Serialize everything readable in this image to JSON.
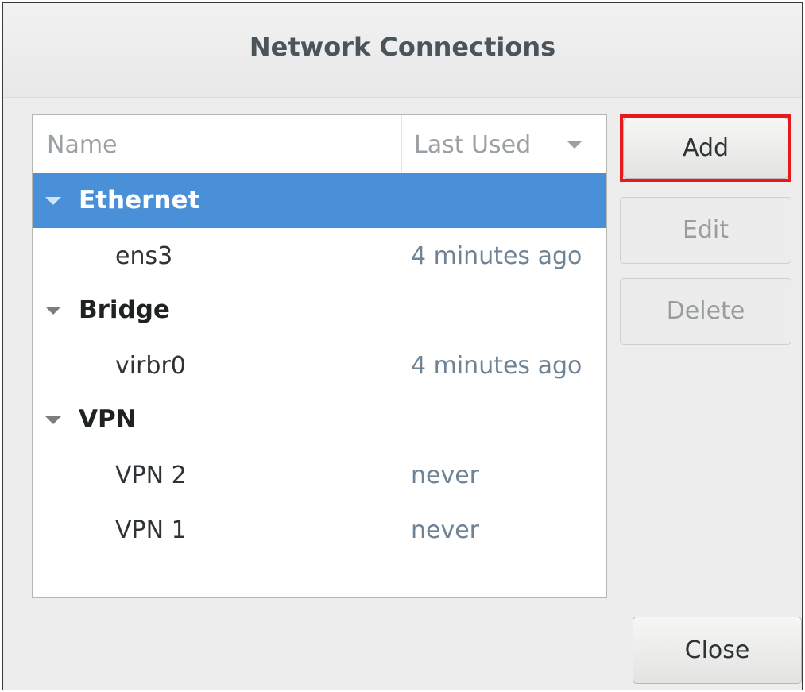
{
  "window": {
    "title": "Network Connections"
  },
  "list": {
    "columns": {
      "name": "Name",
      "last_used": "Last Used"
    },
    "groups": [
      {
        "label": "Ethernet",
        "selected": true,
        "connections": [
          {
            "name": "ens3",
            "last_used": "4 minutes ago"
          }
        ]
      },
      {
        "label": "Bridge",
        "selected": false,
        "connections": [
          {
            "name": "virbr0",
            "last_used": "4 minutes ago"
          }
        ]
      },
      {
        "label": "VPN",
        "selected": false,
        "connections": [
          {
            "name": "VPN 2",
            "last_used": "never"
          },
          {
            "name": "VPN 1",
            "last_used": "never"
          }
        ]
      }
    ]
  },
  "buttons": {
    "add": "Add",
    "edit": "Edit",
    "delete": "Delete",
    "close": "Close"
  },
  "icons": {
    "sort": "chevron-down-icon",
    "expander": "triangle-down-icon"
  },
  "colors": {
    "selection": "#4a90d9",
    "highlight_box": "#e8191c",
    "timestamp": "#6f8396"
  }
}
